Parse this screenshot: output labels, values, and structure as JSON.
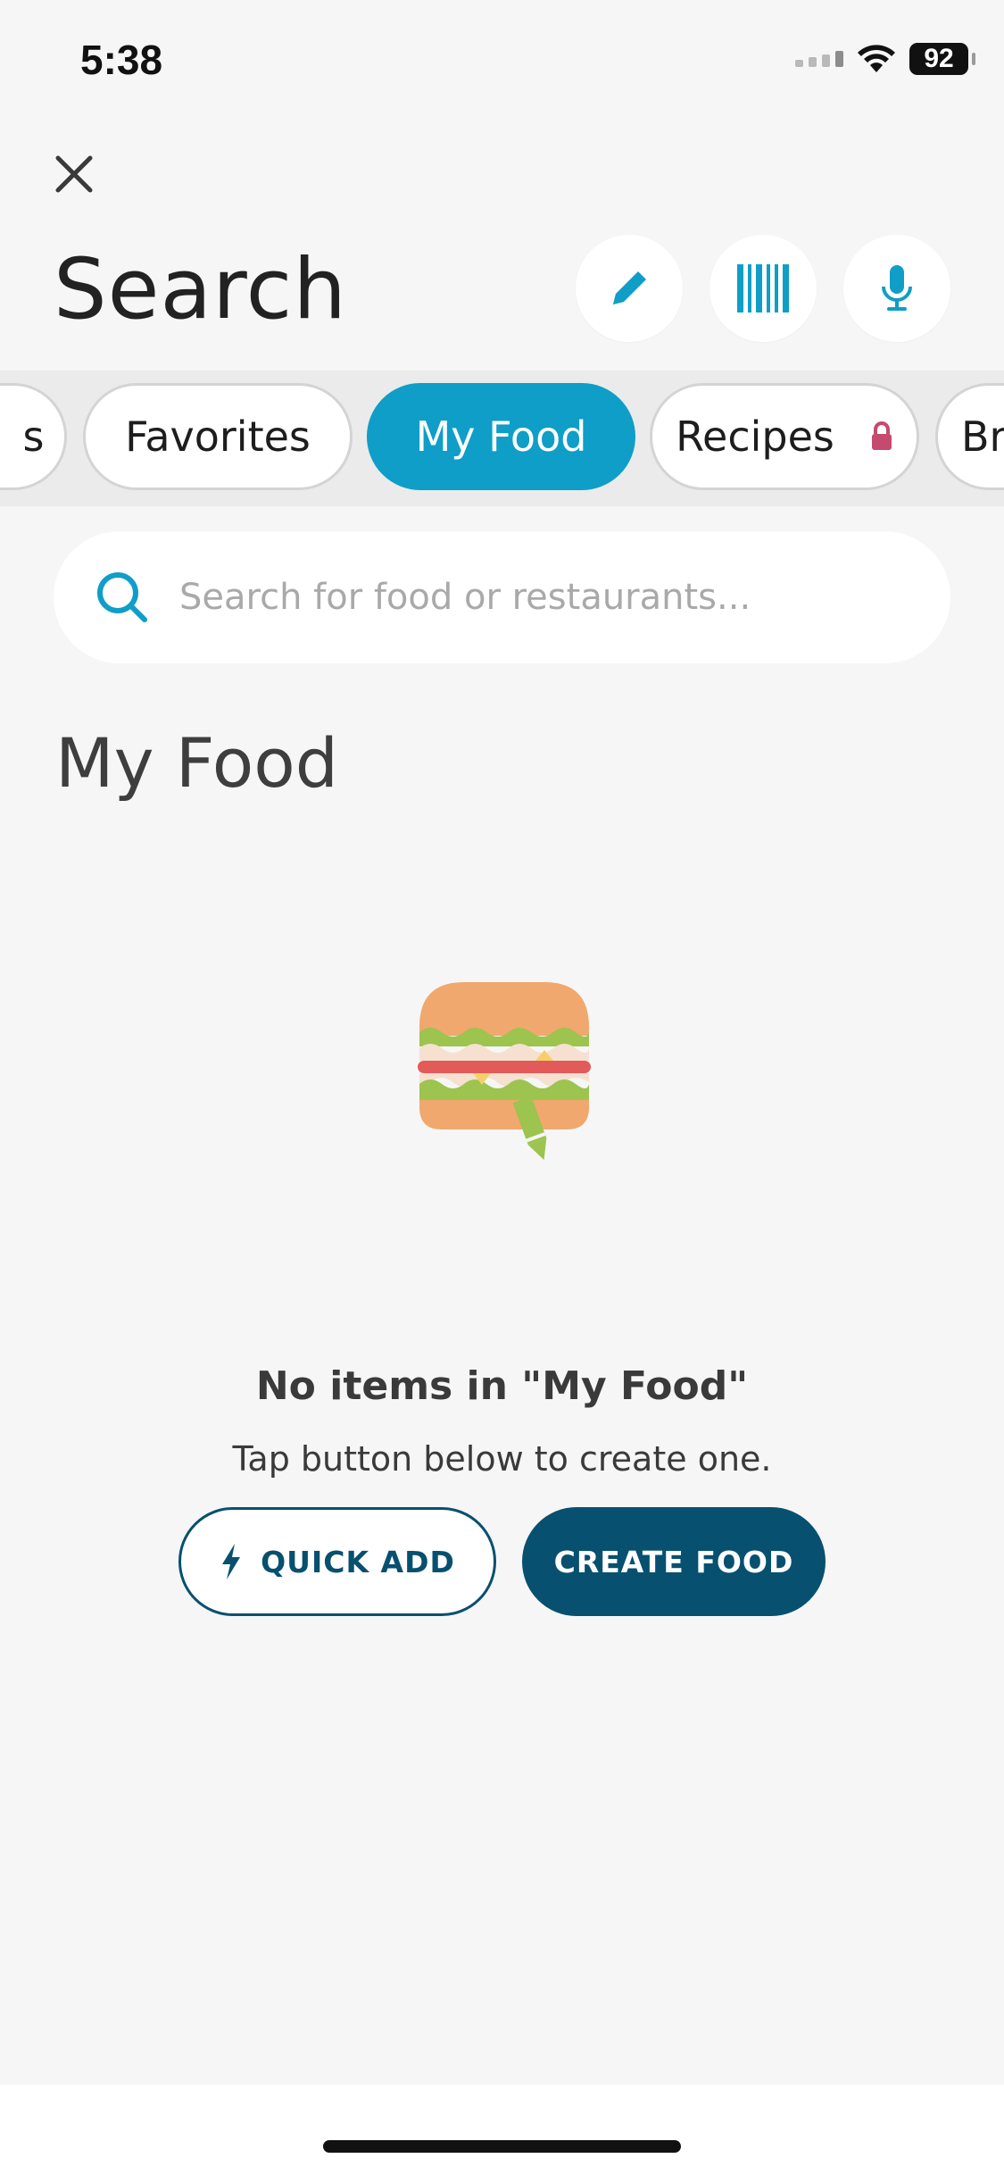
{
  "status_bar": {
    "time": "5:38",
    "battery": "92"
  },
  "header": {
    "title": "Search",
    "close_icon": "close-icon",
    "actions": [
      "pencil-icon",
      "barcode-icon",
      "microphone-icon"
    ]
  },
  "tabs": [
    {
      "label": "s",
      "active": false
    },
    {
      "label": "Favorites",
      "active": false
    },
    {
      "label": "My Food",
      "active": true
    },
    {
      "label": "Recipes",
      "active": false,
      "locked": true
    },
    {
      "label": "Br",
      "active": false
    }
  ],
  "search": {
    "placeholder": "Search for food or restaurants..."
  },
  "section": {
    "title": "My Food"
  },
  "empty_state": {
    "title": "No items in \"My Food\"",
    "subtitle": "Tap button below to create one.",
    "quick_add_label": "QUICK ADD",
    "create_food_label": "CREATE FOOD"
  },
  "colors": {
    "accent": "#0f9ec8",
    "primary_dark": "#07506f",
    "lock": "#c64a6e"
  }
}
